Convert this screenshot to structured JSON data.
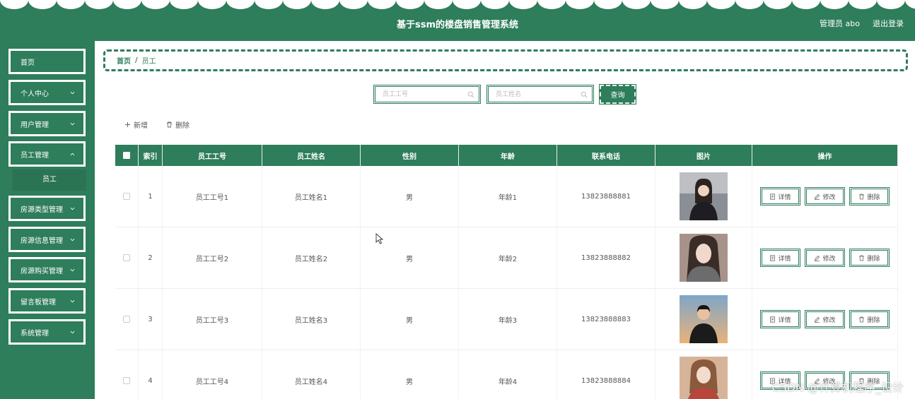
{
  "header": {
    "title": "基于ssm的楼盘销售管理系统",
    "user": "管理员 abo",
    "logout": "退出登录"
  },
  "sidebar": {
    "items": [
      {
        "label": "首页",
        "has_arrow": false
      },
      {
        "label": "个人中心",
        "has_arrow": true
      },
      {
        "label": "用户管理",
        "has_arrow": true
      },
      {
        "label": "员工管理",
        "has_arrow": true
      },
      {
        "label": "房源类型管理",
        "has_arrow": true
      },
      {
        "label": "房源信息管理",
        "has_arrow": true
      },
      {
        "label": "房源购买管理",
        "has_arrow": true
      },
      {
        "label": "留言板管理",
        "has_arrow": true
      },
      {
        "label": "系统管理",
        "has_arrow": true
      }
    ],
    "submenu": {
      "label": "员工"
    }
  },
  "breadcrumb": {
    "home": "首页",
    "separator": "/",
    "current": "员工"
  },
  "search": {
    "field1_placeholder": "员工工号",
    "field2_placeholder": "员工姓名",
    "button": "查询"
  },
  "toolbar": {
    "add": "新增",
    "delete": "删除"
  },
  "table": {
    "headers": [
      "索引",
      "员工工号",
      "员工姓名",
      "性别",
      "年龄",
      "联系电话",
      "图片",
      "操作"
    ],
    "rows": [
      {
        "index": "1",
        "emp_no": "员工工号1",
        "name": "员工姓名1",
        "gender": "男",
        "age": "年龄1",
        "phone": "13823888881"
      },
      {
        "index": "2",
        "emp_no": "员工工号2",
        "name": "员工姓名2",
        "gender": "男",
        "age": "年龄2",
        "phone": "13823888882"
      },
      {
        "index": "3",
        "emp_no": "员工工号3",
        "name": "员工姓名3",
        "gender": "男",
        "age": "年龄3",
        "phone": "13823888883"
      },
      {
        "index": "4",
        "emp_no": "员工工号4",
        "name": "员工姓名4",
        "gender": "男",
        "age": "年龄4",
        "phone": "13823888884"
      }
    ],
    "actions": {
      "detail": "详情",
      "edit": "修改",
      "delete": "删除"
    }
  },
  "watermark": "CSDN @计算机程序_设计",
  "colors": {
    "primary": "#2e7d5b",
    "white": "#ffffff"
  }
}
